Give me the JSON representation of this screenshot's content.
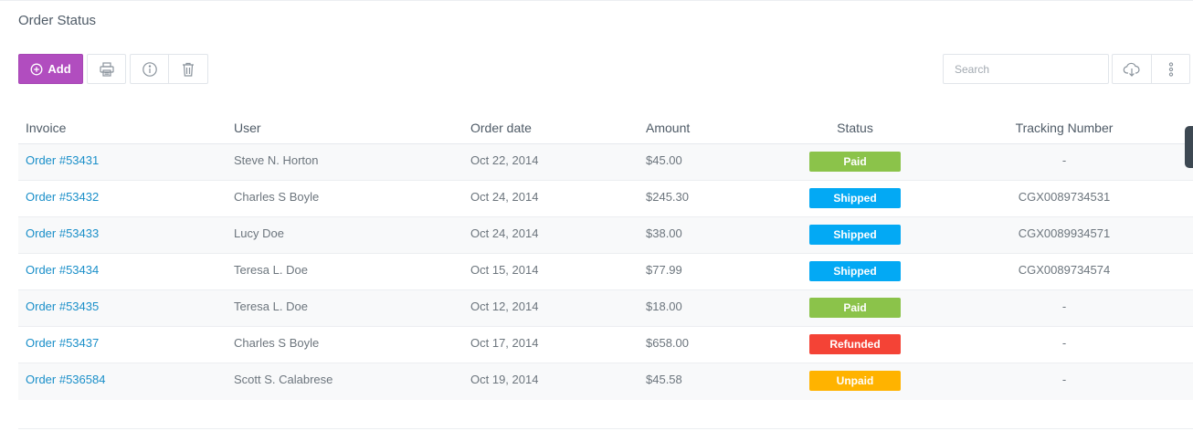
{
  "card": {
    "title": "Order Status"
  },
  "toolbar": {
    "add_label": "Add",
    "add_icon": "plus-circle-icon",
    "print_icon": "printer-icon",
    "info_icon": "info-icon",
    "delete_icon": "trash-icon",
    "download_icon": "cloud-download-icon",
    "more_icon": "more-vertical-icon"
  },
  "search": {
    "placeholder": "Search",
    "value": ""
  },
  "table": {
    "columns": {
      "invoice": "Invoice",
      "user": "User",
      "date": "Order date",
      "amount": "Amount",
      "status": "Status",
      "tracking": "Tracking Number"
    },
    "rows": [
      {
        "invoice": "Order #53431",
        "user": "Steve N. Horton",
        "date": "Oct 22, 2014",
        "amount": "$45.00",
        "status": "Paid",
        "status_color": "#8bc34a",
        "tracking": "-"
      },
      {
        "invoice": "Order #53432",
        "user": "Charles S Boyle",
        "date": "Oct 24, 2014",
        "amount": "$245.30",
        "status": "Shipped",
        "status_color": "#03a9f4",
        "tracking": "CGX0089734531"
      },
      {
        "invoice": "Order #53433",
        "user": "Lucy Doe",
        "date": "Oct 24, 2014",
        "amount": "$38.00",
        "status": "Shipped",
        "status_color": "#03a9f4",
        "tracking": "CGX0089934571"
      },
      {
        "invoice": "Order #53434",
        "user": "Teresa L. Doe",
        "date": "Oct 15, 2014",
        "amount": "$77.99",
        "status": "Shipped",
        "status_color": "#03a9f4",
        "tracking": "CGX0089734574"
      },
      {
        "invoice": "Order #53435",
        "user": "Teresa L. Doe",
        "date": "Oct 12, 2014",
        "amount": "$18.00",
        "status": "Paid",
        "status_color": "#8bc34a",
        "tracking": "-"
      },
      {
        "invoice": "Order #53437",
        "user": "Charles S Boyle",
        "date": "Oct 17, 2014",
        "amount": "$658.00",
        "status": "Refunded",
        "status_color": "#f44336",
        "tracking": "-"
      },
      {
        "invoice": "Order #536584",
        "user": "Scott S. Calabrese",
        "date": "Oct 19, 2014",
        "amount": "$45.58",
        "status": "Unpaid",
        "status_color": "#ffb300",
        "tracking": "-"
      }
    ]
  },
  "colors": {
    "accent": "#b14dbf",
    "link": "#1a8fc9"
  }
}
